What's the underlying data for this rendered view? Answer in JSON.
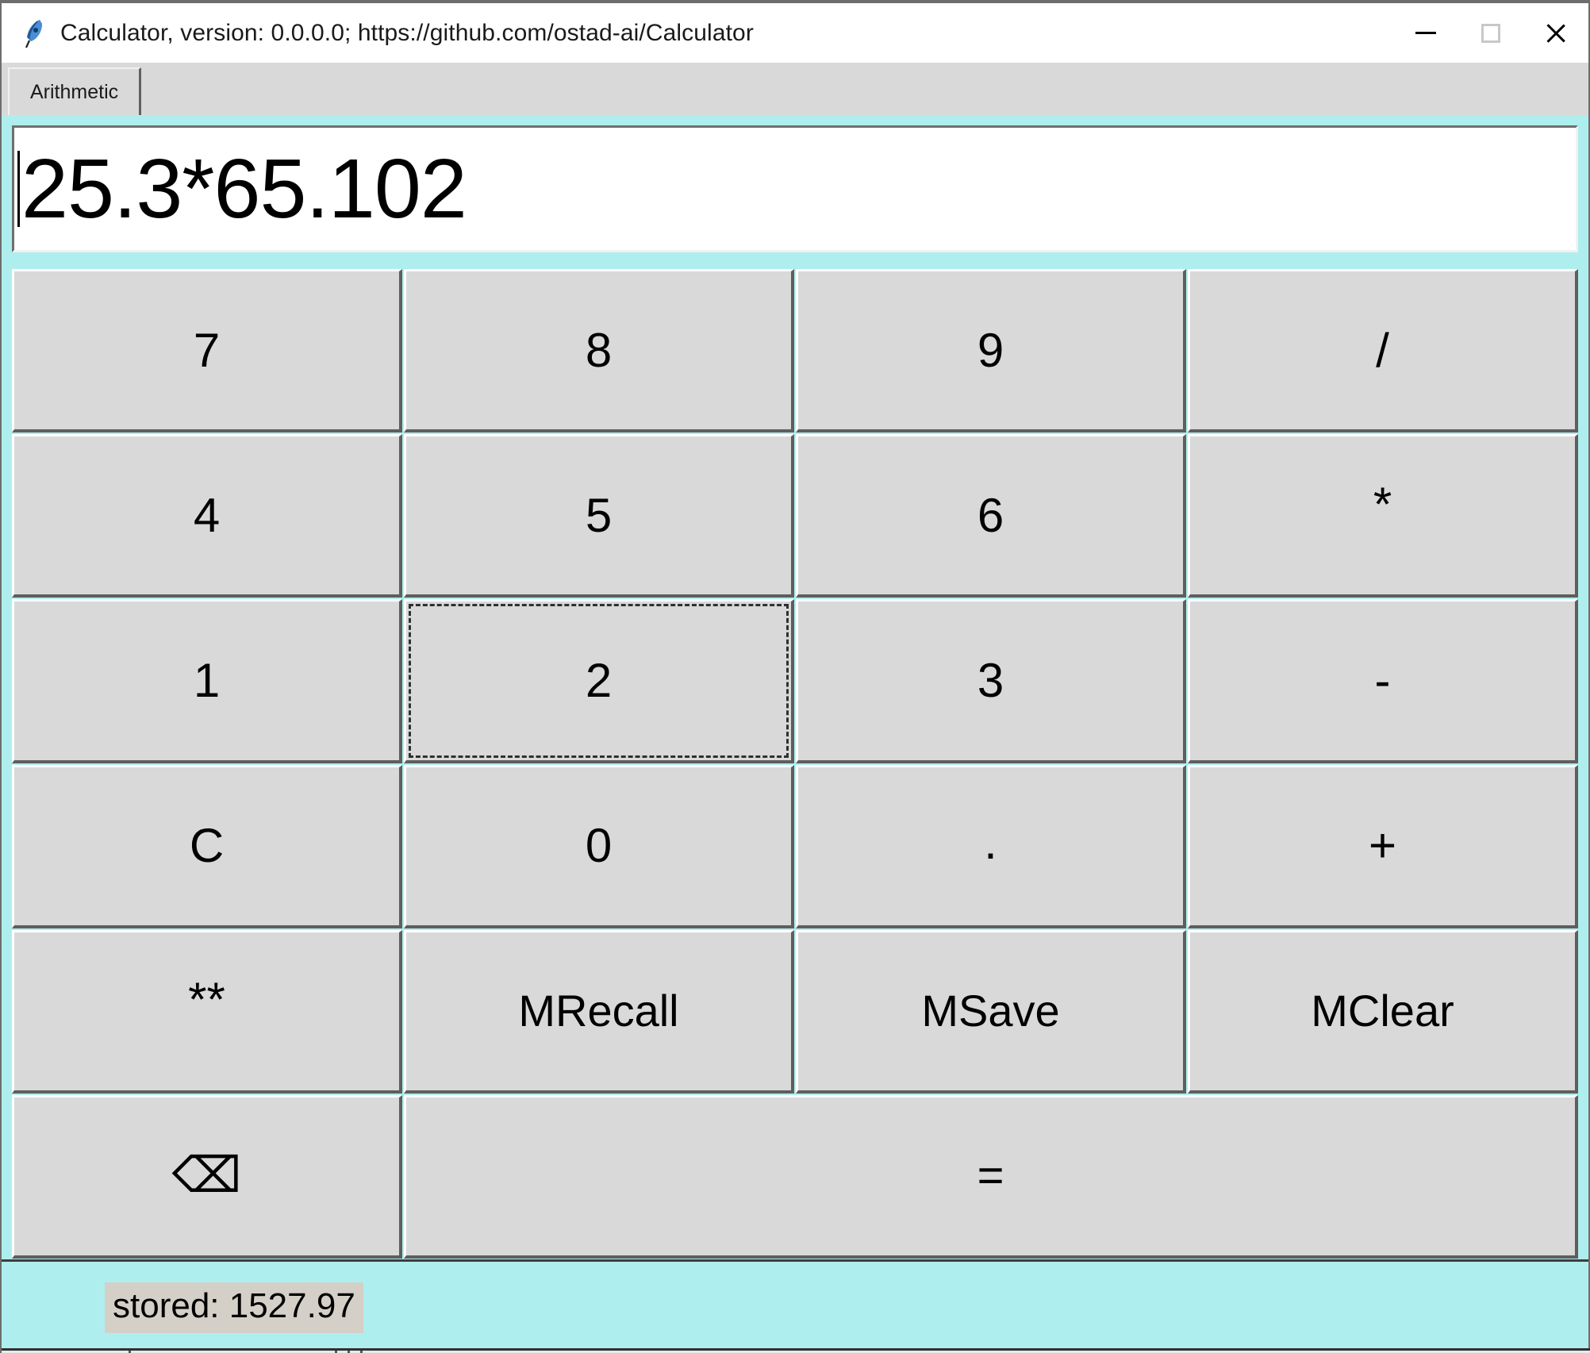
{
  "window": {
    "title": "Calculator, version: 0.0.0.0; https://github.com/ostad-ai/Calculator",
    "icon": "feather-icon",
    "controls": {
      "minimize": "minimize-icon",
      "maximize": "maximize-icon",
      "close": "close-icon"
    },
    "colors": {
      "accent_background": "#afeeee",
      "button_face": "#d9d9d9",
      "display_background": "#ffffff",
      "status_label_background": "#d4d0c8",
      "text": "#000000"
    }
  },
  "tabs": [
    {
      "label": "Arithmetic",
      "selected": true
    }
  ],
  "display": {
    "value": "25.3*65.102",
    "caret_visible": true
  },
  "keypad": {
    "rows": [
      [
        {
          "label": "7",
          "name": "button-7",
          "style": "normal",
          "focused": false
        },
        {
          "label": "8",
          "name": "button-8",
          "style": "normal",
          "focused": false
        },
        {
          "label": "9",
          "name": "button-9",
          "style": "normal",
          "focused": false
        },
        {
          "label": "/",
          "name": "button-divide",
          "style": "normal",
          "focused": false
        }
      ],
      [
        {
          "label": "4",
          "name": "button-4",
          "style": "normal",
          "focused": false
        },
        {
          "label": "5",
          "name": "button-5",
          "style": "normal",
          "focused": false
        },
        {
          "label": "6",
          "name": "button-6",
          "style": "normal",
          "focused": false
        },
        {
          "label": "*",
          "name": "button-multiply",
          "style": "stars",
          "focused": false
        }
      ],
      [
        {
          "label": "1",
          "name": "button-1",
          "style": "normal",
          "focused": false
        },
        {
          "label": "2",
          "name": "button-2",
          "style": "normal",
          "focused": true
        },
        {
          "label": "3",
          "name": "button-3",
          "style": "normal",
          "focused": false
        },
        {
          "label": "-",
          "name": "button-minus",
          "style": "normal",
          "focused": false
        }
      ],
      [
        {
          "label": "C",
          "name": "button-clear",
          "style": "normal",
          "focused": false
        },
        {
          "label": "0",
          "name": "button-0",
          "style": "normal",
          "focused": false
        },
        {
          "label": ".",
          "name": "button-decimal",
          "style": "dot",
          "focused": false
        },
        {
          "label": "+",
          "name": "button-plus",
          "style": "normal",
          "focused": false
        }
      ],
      [
        {
          "label": "**",
          "name": "button-power",
          "style": "stars",
          "focused": false
        },
        {
          "label": "MRecall",
          "name": "button-mrecall",
          "style": "small",
          "focused": false
        },
        {
          "label": "MSave",
          "name": "button-msave",
          "style": "small",
          "focused": false
        },
        {
          "label": "MClear",
          "name": "button-mclear",
          "style": "small",
          "focused": false
        }
      ],
      [
        {
          "label": "⌫",
          "name": "button-backspace",
          "style": "bksp",
          "focused": false
        },
        {
          "label": "=",
          "name": "button-equals",
          "style": "eq",
          "focused": false,
          "span": 3
        }
      ]
    ]
  },
  "status": {
    "text": "stored: 1527.97"
  }
}
